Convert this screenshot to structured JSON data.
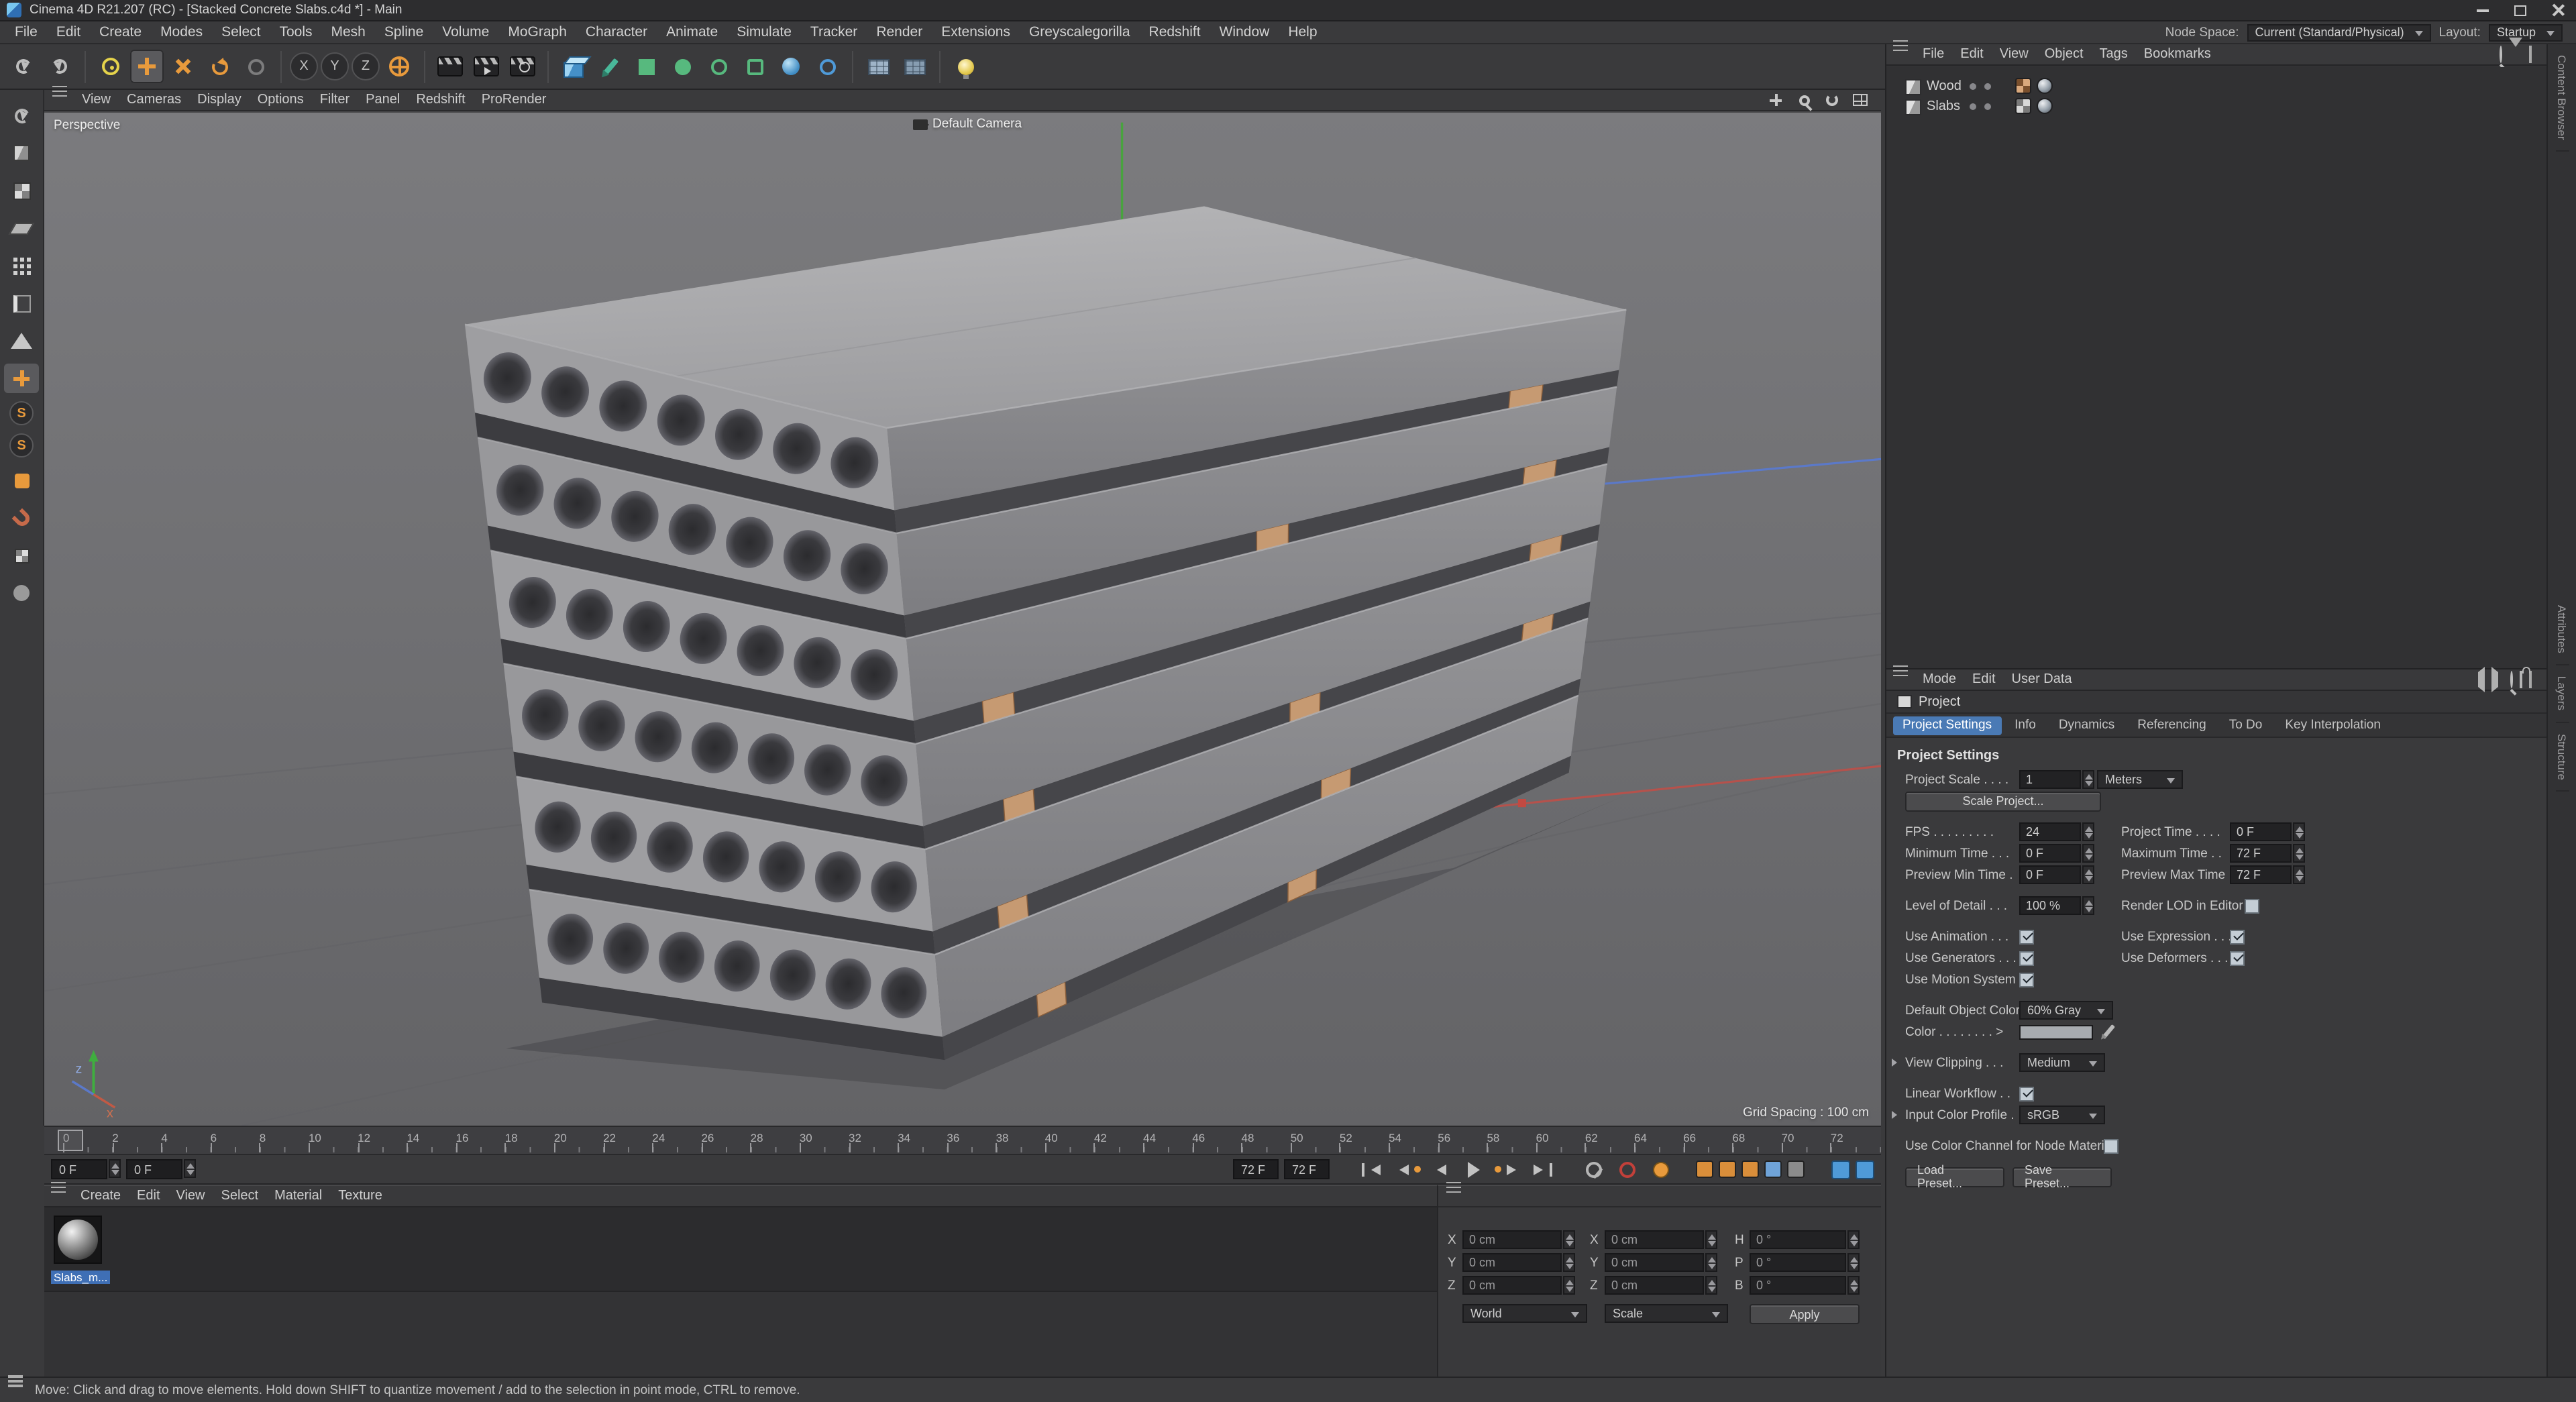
{
  "title_bar": {
    "app_title": "Cinema 4D R21.207 (RC) - [Stacked Concrete Slabs.c4d *] - Main"
  },
  "menu_bar": {
    "items": [
      "File",
      "Edit",
      "Create",
      "Modes",
      "Select",
      "Tools",
      "Mesh",
      "Spline",
      "Volume",
      "MoGraph",
      "Character",
      "Animate",
      "Simulate",
      "Tracker",
      "Render",
      "Extensions",
      "Greyscalegorilla",
      "Redshift",
      "Window",
      "Help"
    ],
    "node_space_label": "Node Space:",
    "node_space_value": "Current (Standard/Physical)",
    "layout_label": "Layout:",
    "layout_value": "Startup"
  },
  "toolbar": {
    "axis_x": "X",
    "axis_y": "Y",
    "axis_z": "Z"
  },
  "left_toolbar": {
    "snap_letter": "S"
  },
  "viewport": {
    "menu": [
      "View",
      "Cameras",
      "Display",
      "Options",
      "Filter",
      "Panel",
      "Redshift",
      "ProRender"
    ],
    "view_label": "Perspective",
    "camera_label": "Default Camera",
    "grid_label": "Grid Spacing : 100 cm",
    "axis_x_label": "x",
    "axis_z_label": "z"
  },
  "timeline": {
    "marks": [
      "0",
      "2",
      "4",
      "6",
      "8",
      "10",
      "12",
      "14",
      "16",
      "18",
      "20",
      "22",
      "24",
      "26",
      "28",
      "30",
      "32",
      "34",
      "36",
      "38",
      "40",
      "42",
      "44",
      "46",
      "48",
      "50",
      "52",
      "54",
      "56",
      "58",
      "60",
      "62",
      "64",
      "66",
      "68",
      "70",
      "72"
    ]
  },
  "transport": {
    "frame_field_1": "0 F",
    "frame_field_2": "0 F",
    "range_field_1": "72 F",
    "range_field_2": "72 F"
  },
  "materials": {
    "menu": [
      "Create",
      "Edit",
      "View",
      "Select",
      "Material",
      "Texture"
    ],
    "material_name": "Slabs_m..."
  },
  "coordinates": {
    "pos_x_label": "X",
    "pos_y_label": "Y",
    "pos_z_label": "Z",
    "pos_x": "0 cm",
    "pos_y": "0 cm",
    "pos_z": "0 cm",
    "size_x_label": "X",
    "size_y_label": "Y",
    "size_z_label": "Z",
    "size_x": "0 cm",
    "size_y": "0 cm",
    "size_z": "0 cm",
    "rot_h_label": "H",
    "rot_p_label": "P",
    "rot_b_label": "B",
    "rot_h": "0 °",
    "rot_p": "0 °",
    "rot_b": "0 °",
    "system": "World",
    "mode": "Scale",
    "apply_label": "Apply"
  },
  "object_manager": {
    "menu": [
      "File",
      "Edit",
      "View",
      "Object",
      "Tags",
      "Bookmarks"
    ],
    "objects": [
      {
        "name": "Wood"
      },
      {
        "name": "Slabs"
      }
    ]
  },
  "attributes": {
    "tabs": [
      "Mode",
      "Edit",
      "User Data"
    ],
    "object_label": "Project",
    "sections": [
      "Project Settings",
      "Info",
      "Dynamics",
      "Referencing",
      "To Do",
      "Key Interpolation"
    ],
    "header": "Project Settings",
    "project_scale_label": "Project Scale . . . .",
    "project_scale": "1",
    "project_scale_unit": "Meters",
    "scale_project_button": "Scale Project...",
    "fps_label": "FPS . . . . . . . . .",
    "fps": "24",
    "project_time_label": "Project Time . . . .",
    "project_time": "0 F",
    "minimum_time_label": "Minimum Time . . .",
    "minimum_time": "0 F",
    "maximum_time_label": "Maximum Time . .",
    "maximum_time": "72 F",
    "preview_min_label": "Preview Min Time .",
    "preview_min": "0 F",
    "preview_max_label": "Preview Max Time .",
    "preview_max": "72 F",
    "lod_label": "Level of Detail . . .",
    "lod_value": "100 %",
    "render_lod_label": "Render LOD in Editor",
    "use_animation_label": "Use Animation . . .",
    "use_expression_label": "Use Expression . . .",
    "use_generators_label": "Use Generators . . .",
    "use_deformers_label": "Use Deformers . . .",
    "use_motion_label": "Use Motion System .",
    "default_color_label": "Default Object Color .",
    "default_color_value": "60% Gray",
    "color_label": "Color . . . . . . . . >",
    "view_clipping_label": "View Clipping . . .",
    "view_clipping_value": "Medium",
    "linear_workflow_label": "Linear Workflow . .",
    "input_profile_label": "Input Color Profile .",
    "input_profile_value": "sRGB",
    "node_material_label": "Use Color Channel for Node Material",
    "load_preset_button": "Load Preset...",
    "save_preset_button": "Save Preset...",
    "checks": {
      "render_lod": false,
      "use_animation": true,
      "use_expression": true,
      "use_generators": true,
      "use_deformers": true,
      "use_motion": true,
      "linear_workflow": true,
      "node_material": false
    }
  },
  "side_tabs": [
    "Content Browser",
    "Attributes",
    "Layers",
    "Structure"
  ],
  "status_bar": {
    "text": "Move: Click and drag to move elements. Hold down SHIFT to quantize movement / add to the selection in point mode, CTRL to remove."
  }
}
